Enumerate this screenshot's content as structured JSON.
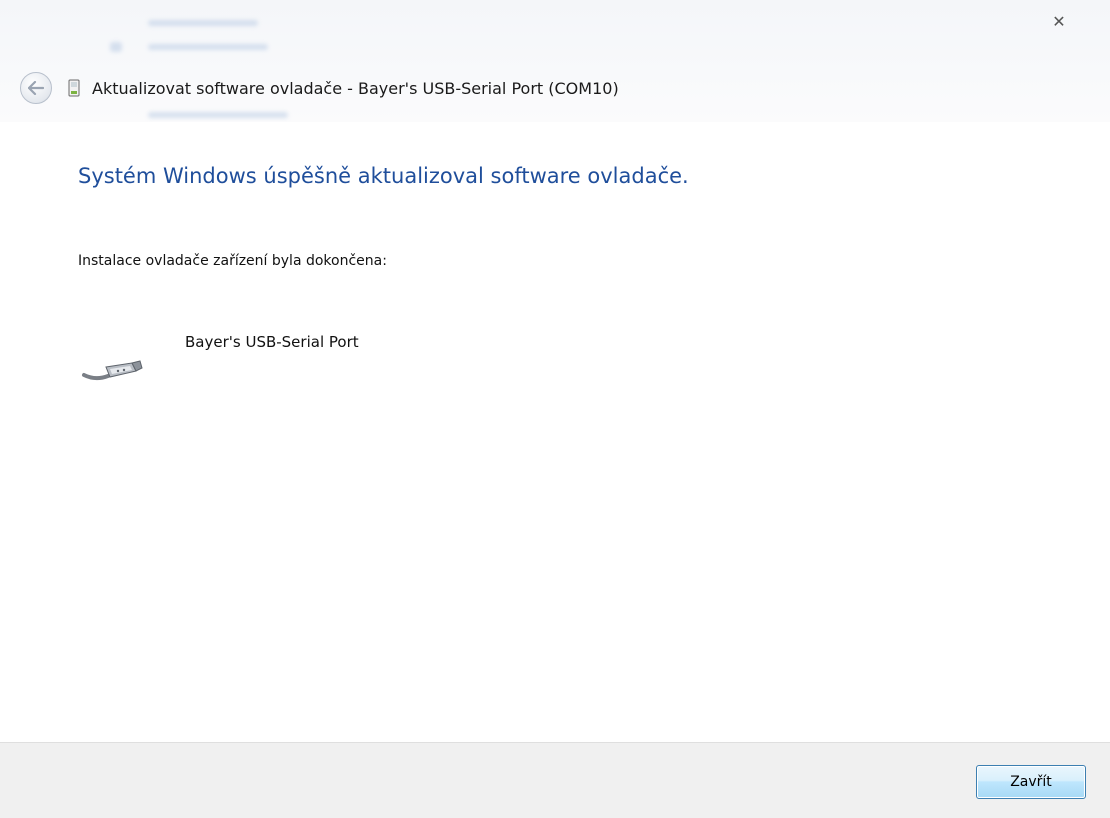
{
  "window": {
    "title": "Aktualizovat software ovladače - Bayer's USB-Serial Port (COM10)",
    "close_glyph": "✕"
  },
  "content": {
    "heading": "Systém Windows úspěšně aktualizoval software ovladače.",
    "subtext": "Instalace ovladače zařízení byla dokončena:",
    "device_name": "Bayer's USB-Serial Port"
  },
  "footer": {
    "close_button_label": "Zavřít"
  },
  "colors": {
    "heading": "#1f4e9b",
    "button_border": "#3c7fb1",
    "footer_bg": "#f0f0f0"
  },
  "icons": {
    "back": "back-arrow-icon",
    "title_device": "device-icon",
    "device": "usb-serial-cable-icon",
    "close": "close-icon"
  }
}
